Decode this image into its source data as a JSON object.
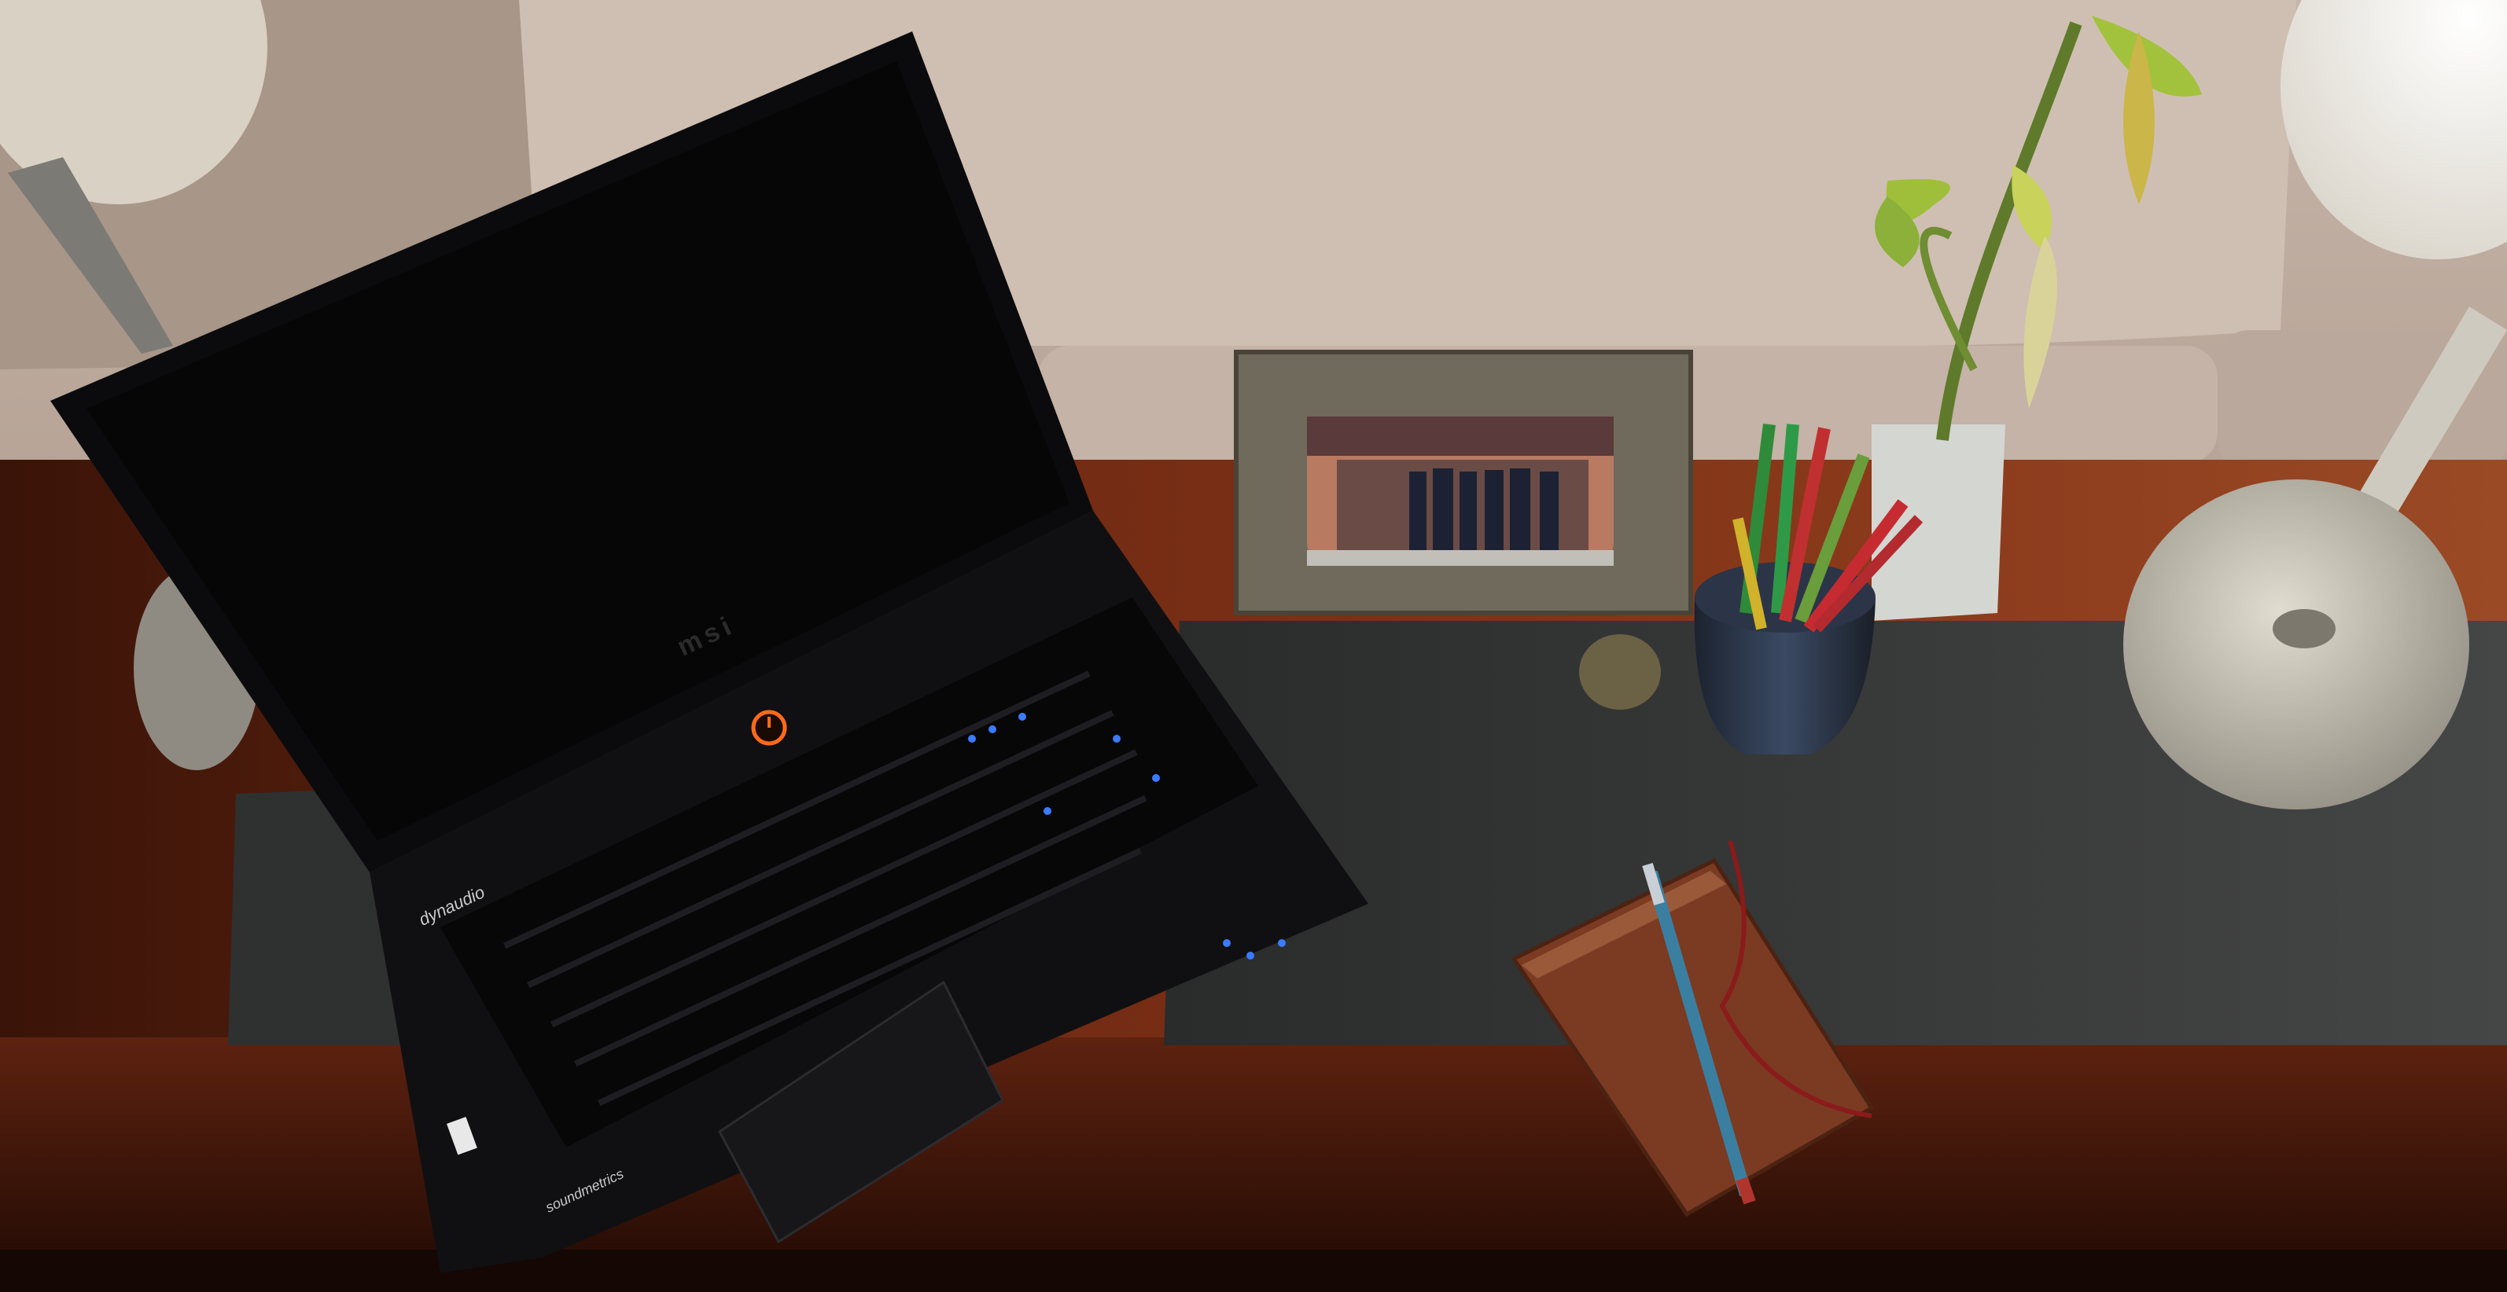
{
  "scene": {
    "description_free": true,
    "laptop": {
      "lid_logo": "msi",
      "speaker_label": "dynaudio",
      "palmrest_label": "soundmetrics",
      "power_icon": "power-icon"
    },
    "colors": {
      "sofa": "#c9b8ab",
      "desk_wood": "#7a2f14",
      "desk_mat": "#3a3b3a",
      "laptop_body": "#0b0b0c",
      "notebook": "#7b3a22",
      "lamp_metal": "#b7b2a6"
    }
  }
}
